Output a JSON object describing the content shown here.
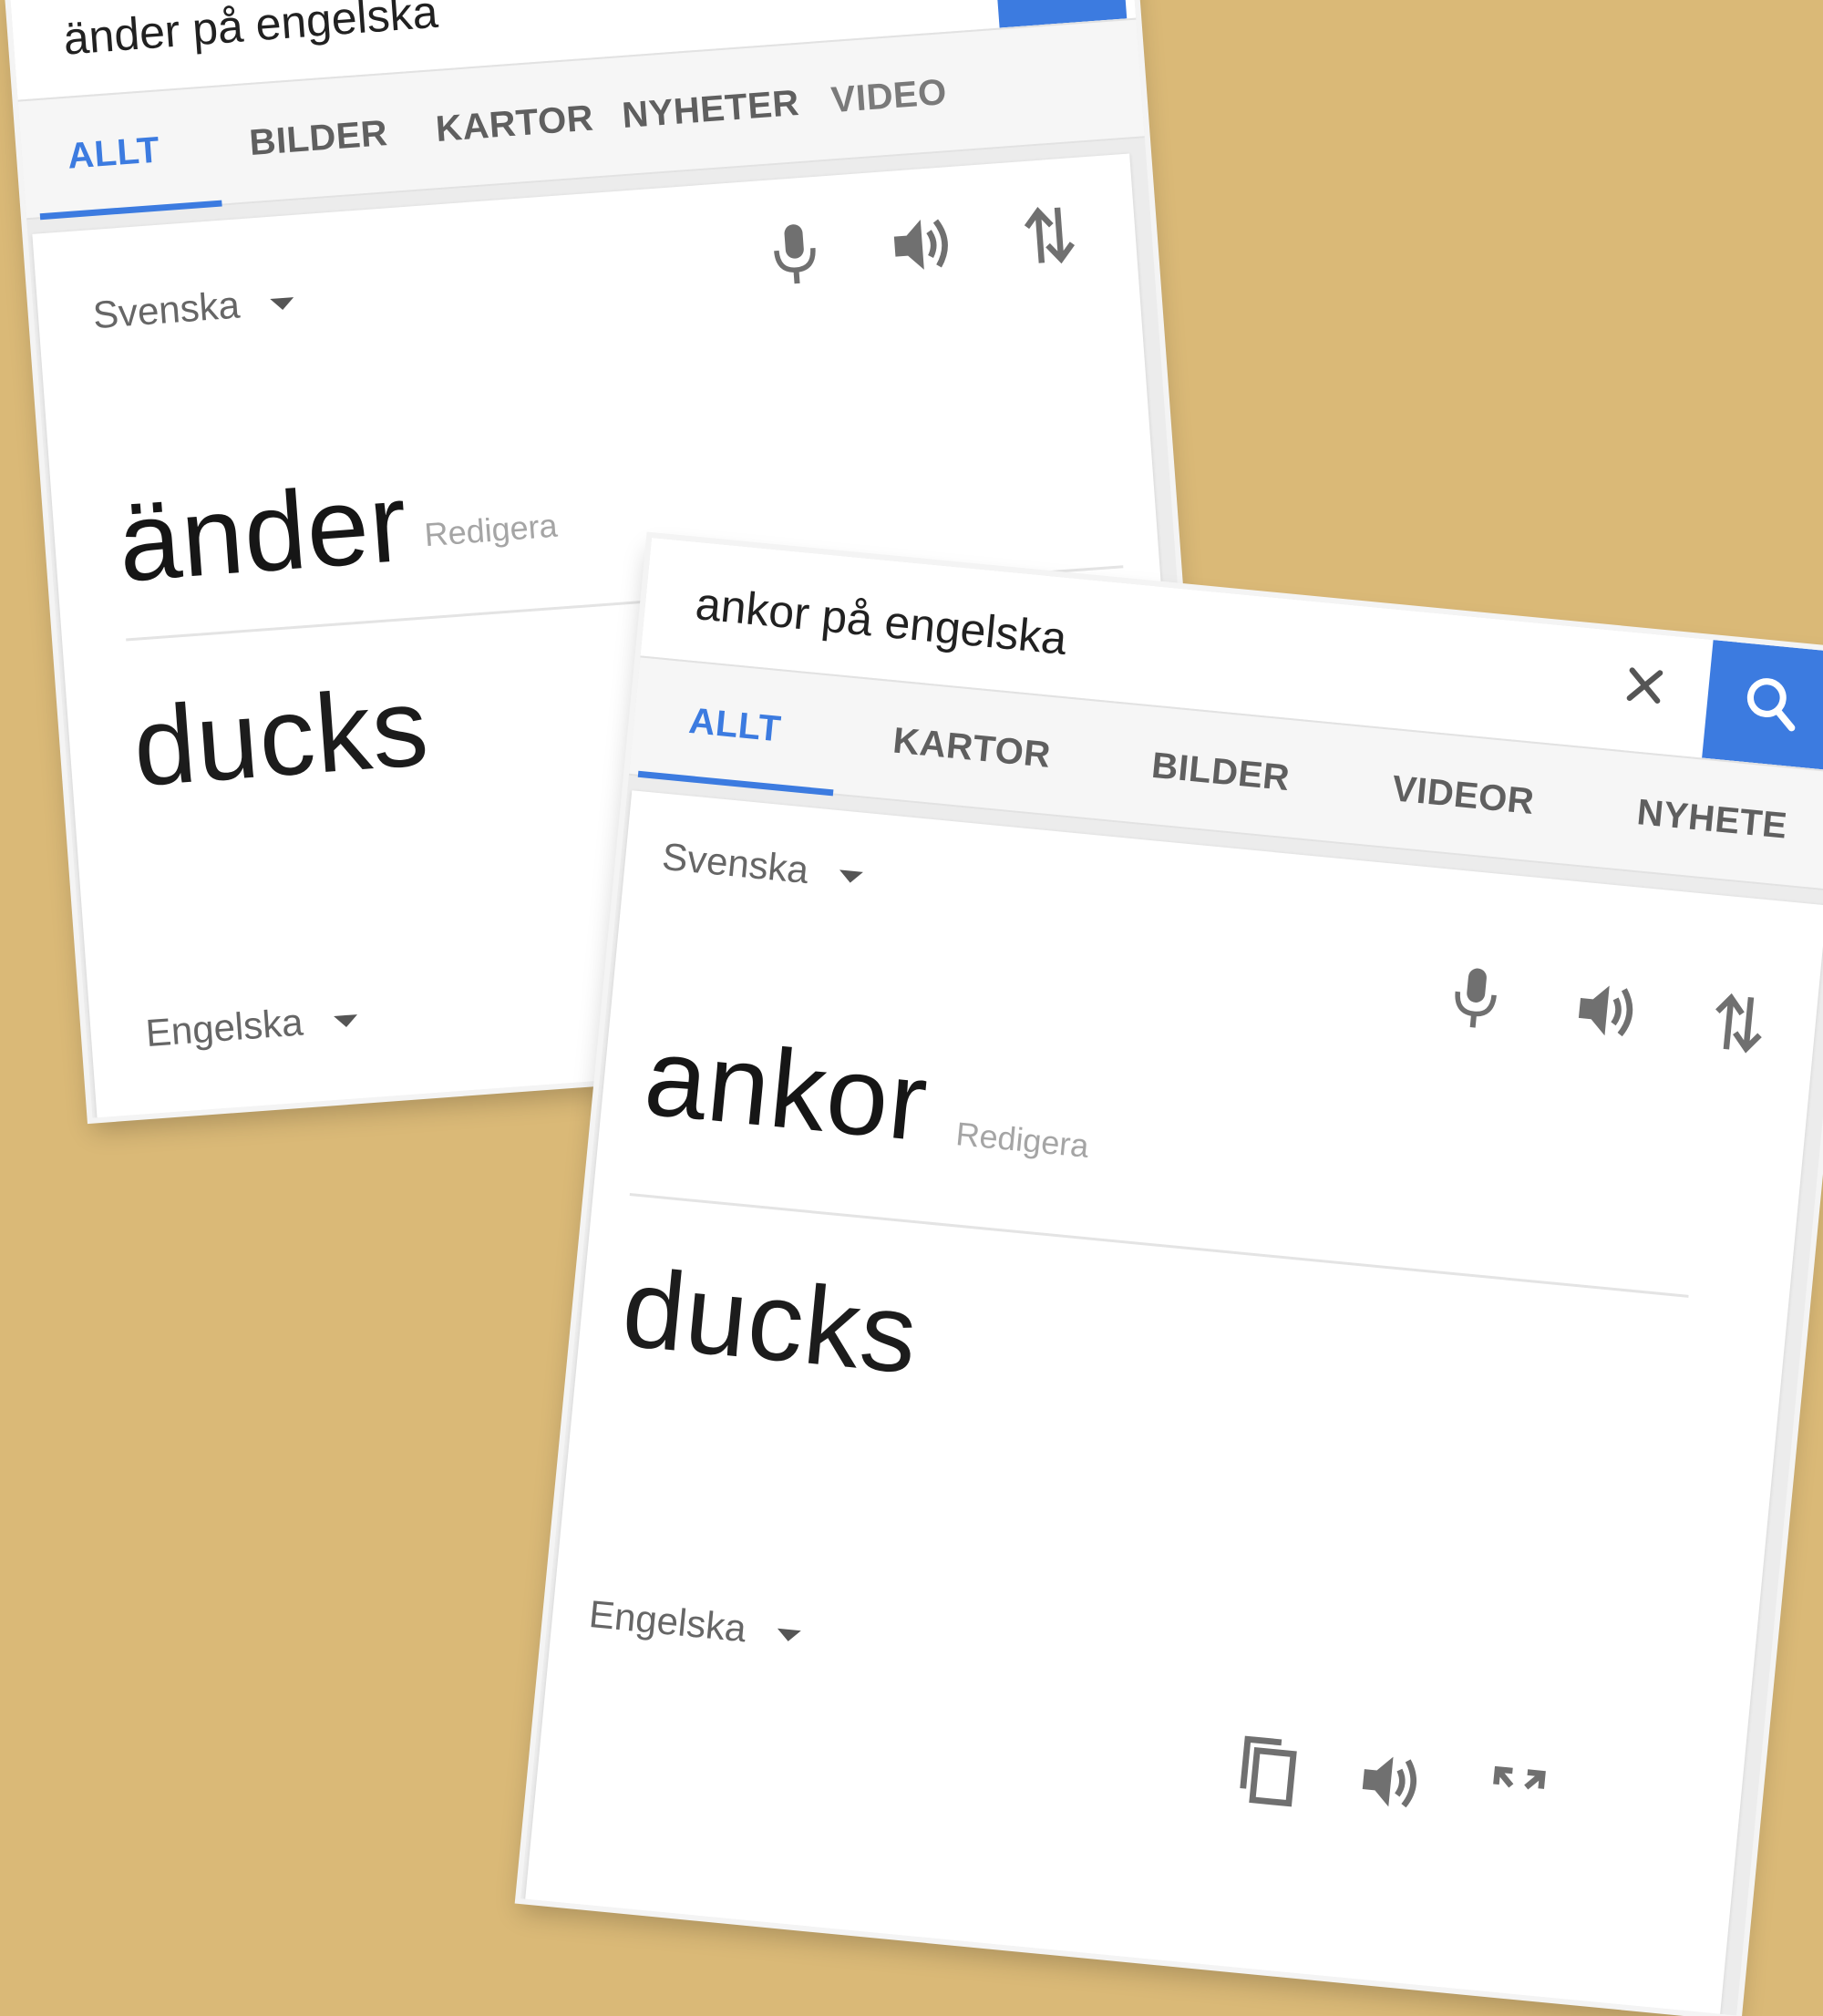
{
  "screens": [
    {
      "search": {
        "query": "änder på engelska"
      },
      "tabs": [
        "ALLT",
        "BILDER",
        "KARTOR",
        "NYHETER",
        "VIDEO"
      ],
      "translator": {
        "source_lang": "Svenska",
        "target_lang": "Engelska",
        "source_text": "änder",
        "edit_label": "Redigera",
        "translation": "ducks"
      }
    },
    {
      "search": {
        "query": "ankor på engelska"
      },
      "tabs": [
        "ALLT",
        "KARTOR",
        "BILDER",
        "VIDEOR",
        "NYHETE"
      ],
      "translator": {
        "source_lang": "Svenska",
        "target_lang": "Engelska",
        "source_text": "ankor",
        "edit_label": "Redigera",
        "translation": "ducks"
      }
    }
  ],
  "icons": {
    "clear": "close-icon",
    "search": "search-icon",
    "mic": "microphone-icon",
    "speaker": "speaker-icon",
    "swap": "swap-icon",
    "copy": "copy-icon",
    "expand": "fullscreen-icon"
  },
  "colors": {
    "background": "#dab977",
    "accent": "#3c7be0",
    "icon": "#707070"
  }
}
